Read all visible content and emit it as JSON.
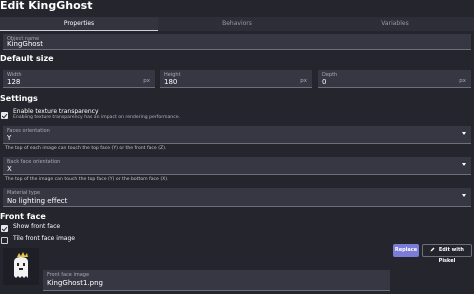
{
  "window": {
    "title": "Edit KingGhost"
  },
  "tabs": [
    {
      "label": "Properties",
      "active": true
    },
    {
      "label": "Behaviors",
      "active": false
    },
    {
      "label": "Variables",
      "active": false
    }
  ],
  "object_name": {
    "label": "Object name",
    "value": "KingGhost"
  },
  "default_size": {
    "heading": "Default size",
    "width": {
      "label": "Width",
      "value": "128",
      "unit": "px"
    },
    "height": {
      "label": "Height",
      "value": "180",
      "unit": "px"
    },
    "depth": {
      "label": "Depth",
      "value": "0",
      "unit": "px"
    }
  },
  "settings": {
    "heading": "Settings",
    "texture_transparency": {
      "label": "Enable texture transparency",
      "hint": "Enabling texture transparency has an impact on rendering performance.",
      "checked": true
    },
    "faces_orientation": {
      "label": "Faces orientation",
      "value": "Y",
      "help": "The top of each image can touch the top face (Y) or the front face (Z)."
    },
    "back_face_orientation": {
      "label": "Back face orientation",
      "value": "X",
      "help": "The top of the image can touch the top face (Y) or the bottom face (X)."
    },
    "material_type": {
      "label": "Material type",
      "value": "No lighting effect"
    }
  },
  "front_face": {
    "heading": "Front face",
    "show_front_face": {
      "label": "Show front face",
      "checked": true
    },
    "tile_front_face": {
      "label": "Tile front face image",
      "checked": false
    },
    "image": {
      "label": "Front face image",
      "value": "KingGhost1.png"
    },
    "replace_label": "Replace",
    "edit_pixel_label": "Edit with Piskel"
  },
  "colors": {
    "accent": "#7b7bd8",
    "background": "#25252e",
    "field": "#373744"
  },
  "icons": {
    "checkbox_checked": "check-icon",
    "dropdown": "chevron-down-icon",
    "edit": "pencil-icon",
    "ghost": "ghost-sprite"
  }
}
